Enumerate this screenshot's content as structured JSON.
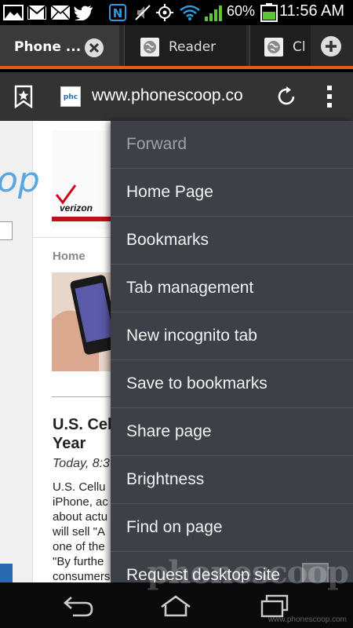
{
  "status_bar": {
    "battery": "60%",
    "time": "11:56 AM",
    "icons": [
      "gallery-icon",
      "gmail-icon",
      "email-icon",
      "twitter-icon",
      "nfc-icon",
      "mute-icon",
      "gps-icon",
      "wifi-icon",
      "signal-icon",
      "battery-icon"
    ]
  },
  "tabs": [
    {
      "title": "Phone ..."
    },
    {
      "title": "Reader"
    },
    {
      "title": "Cl"
    }
  ],
  "address_bar": {
    "url": "www.phonescoop.co"
  },
  "webpage": {
    "logo_text": "op",
    "breadcrumb": "Home",
    "headline_line1": "U.S. Cel",
    "headline_line2": "Year",
    "dateline": "Today, 8:3",
    "body_lines": [
      "U.S. Cellu",
      "iPhone, ac",
      "about actu",
      "will sell \"A",
      "one of the",
      "\"By furthe",
      "consumers"
    ],
    "ad_brand": "verizon"
  },
  "menu": {
    "items": [
      {
        "label": "Forward",
        "enabled": false
      },
      {
        "label": "Home Page",
        "enabled": true
      },
      {
        "label": "Bookmarks",
        "enabled": true
      },
      {
        "label": "Tab management",
        "enabled": true
      },
      {
        "label": "New incognito tab",
        "enabled": true
      },
      {
        "label": "Save to bookmarks",
        "enabled": true
      },
      {
        "label": "Share page",
        "enabled": true
      },
      {
        "label": "Brightness",
        "enabled": true
      },
      {
        "label": "Find on page",
        "enabled": true
      },
      {
        "label": "Request desktop site",
        "enabled": true
      }
    ]
  },
  "watermark": {
    "text": "phonescoop",
    "sub": "www.phonescoop.com"
  },
  "colors": {
    "tab_accent": "#e85a1a",
    "menu_bg": "#3d4147",
    "menu_divider": "#50555c",
    "address_bar_bg": "#333333"
  }
}
